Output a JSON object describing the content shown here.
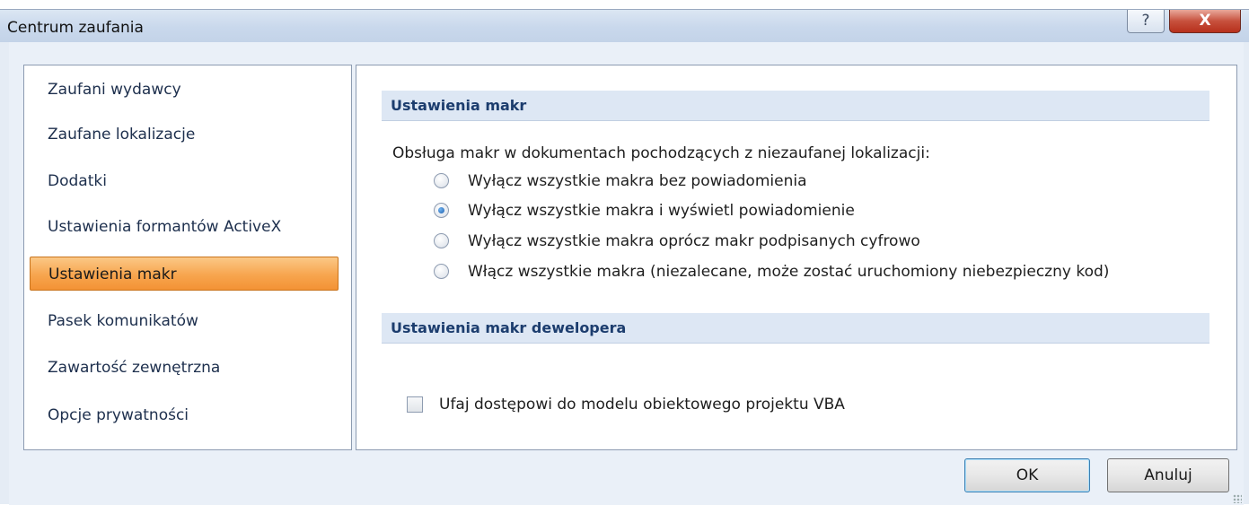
{
  "window": {
    "title": "Centrum zaufania",
    "help_icon": "?",
    "close_icon": "X"
  },
  "nav": {
    "items": [
      {
        "label": "Zaufani wydawcy"
      },
      {
        "label": "Zaufane lokalizacje"
      },
      {
        "label": "Dodatki"
      },
      {
        "label": "Ustawienia formantów ActiveX"
      },
      {
        "label": "Ustawienia makr",
        "selected": true
      },
      {
        "label": "Pasek komunikatów"
      },
      {
        "label": "Zawartość zewnętrzna"
      },
      {
        "label": "Opcje prywatności"
      }
    ]
  },
  "macros": {
    "header": "Ustawienia makr",
    "description": "Obsługa makr w dokumentach pochodzących z niezaufanej lokalizacji:",
    "options": [
      {
        "label": "Wyłącz wszystkie makra bez powiadomienia",
        "checked": false
      },
      {
        "label": "Wyłącz wszystkie makra i wyświetl powiadomienie",
        "checked": true
      },
      {
        "label": "Wyłącz wszystkie makra oprócz makr podpisanych cyfrowo",
        "checked": false
      },
      {
        "label": "Włącz wszystkie makra (niezalecane, może zostać uruchomiony niebezpieczny kod)",
        "checked": false
      }
    ]
  },
  "developer": {
    "header": "Ustawienia makr dewelopera",
    "checkbox_label": "Ufaj dostępowi do modelu obiektowego projektu VBA",
    "checked": false
  },
  "buttons": {
    "ok": "OK",
    "cancel": "Anuluj"
  },
  "colors": {
    "selected_nav": "#f7a54e",
    "section_header_text": "#1c3d6e",
    "close_button": "#c7513d"
  }
}
